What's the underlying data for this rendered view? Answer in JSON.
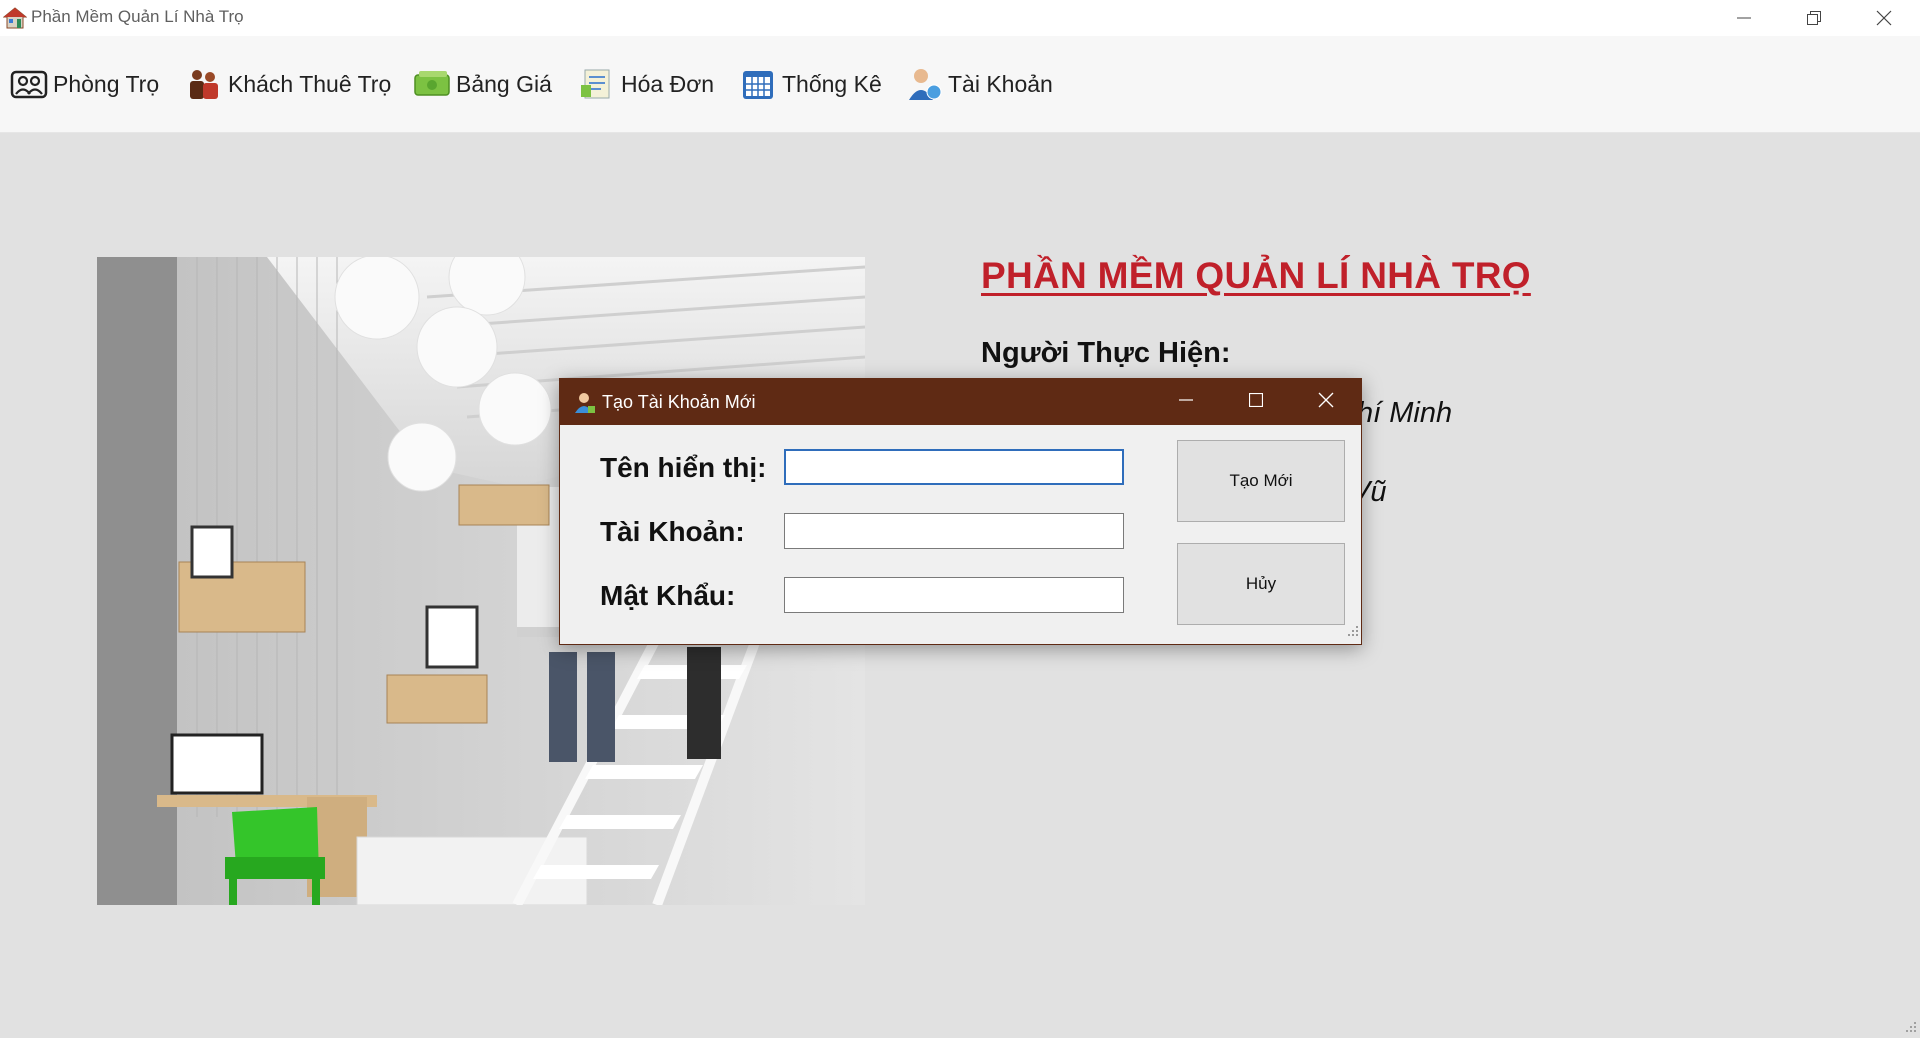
{
  "window": {
    "title": "Phần Mềm Quản Lí Nhà Trọ",
    "app_icon": "house-icon",
    "controls": [
      "minimize-icon",
      "restore-icon",
      "close-icon"
    ]
  },
  "menu": {
    "items": [
      {
        "label": "Phòng Trọ",
        "icon": "room-icon"
      },
      {
        "label": "Khách Thuê Trọ",
        "icon": "tenants-icon"
      },
      {
        "label": "Bảng Giá",
        "icon": "money-icon"
      },
      {
        "label": "Hóa Đơn",
        "icon": "invoice-icon"
      },
      {
        "label": "Thống Kê",
        "icon": "calendar-icon"
      },
      {
        "label": "Tài Khoản",
        "icon": "account-icon"
      }
    ]
  },
  "main": {
    "heading": "PHẦN MỀM QUẢN LÍ NHÀ TRỌ",
    "author_label": "Người Thực Hiện:",
    "partial_line_1": "hí Minh",
    "partial_line_2": "Vũ"
  },
  "dialog": {
    "title": "Tạo Tài Khoản Mới",
    "icon": "user-icon",
    "fields": [
      {
        "label": "Tên hiển thị:",
        "value": ""
      },
      {
        "label": "Tài Khoản:",
        "value": ""
      },
      {
        "label": "Mật Khẩu:",
        "value": ""
      }
    ],
    "create_button": "Tạo Mới",
    "cancel_button": "Hủy"
  },
  "colors": {
    "dialog_titlebar": "#5f2a14",
    "heading": "#c0202a",
    "background": "#e1e1e1",
    "focus_border": "#2f6dbb"
  }
}
